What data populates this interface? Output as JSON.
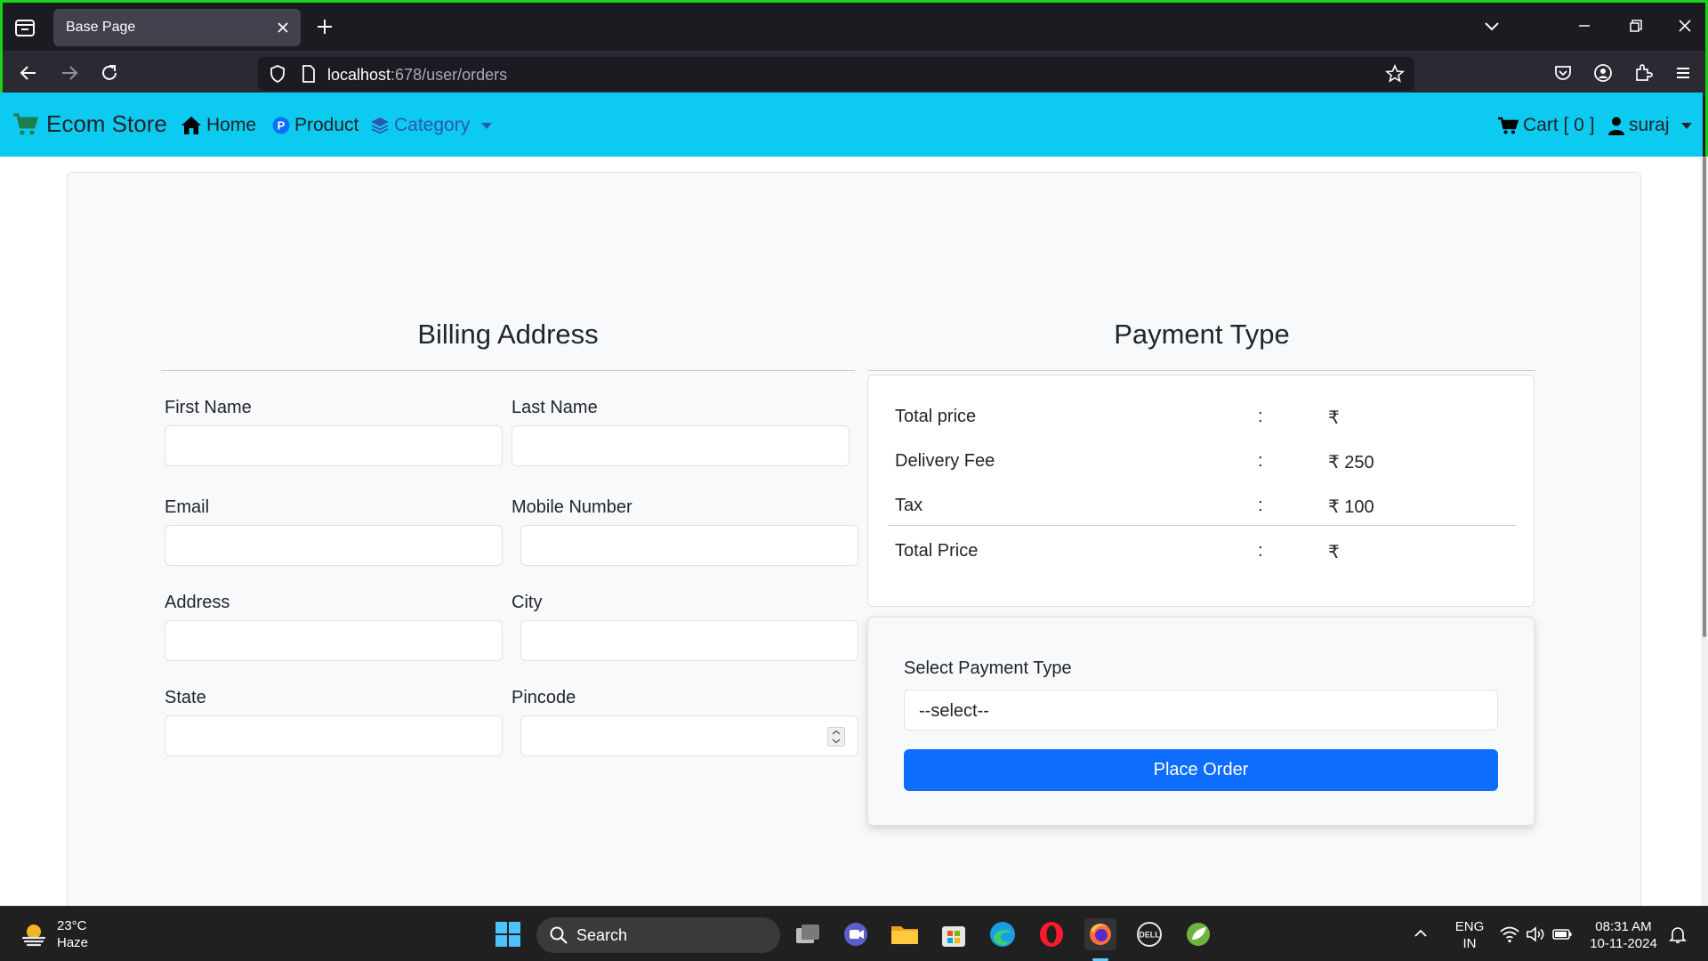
{
  "browser": {
    "tab_title": "Base Page",
    "url_host": "localhost",
    "url_path": ":678/user/orders"
  },
  "site_nav": {
    "brand": "Ecom Store",
    "home": "Home",
    "product": "Product",
    "category": "Category",
    "cart": "Cart [ 0 ]",
    "user": "suraj"
  },
  "billing": {
    "title": "Billing Address",
    "fields": {
      "first_name": "First Name",
      "last_name": "Last Name",
      "email": "Email",
      "mobile": "Mobile Number",
      "address": "Address",
      "city": "City",
      "state": "State",
      "pincode": "Pincode"
    }
  },
  "payment": {
    "title": "Payment Type",
    "summary": [
      {
        "label": "Total price",
        "sep": ":",
        "value": "₹"
      },
      {
        "label": "Delivery Fee",
        "sep": ":",
        "value": "₹ 250"
      },
      {
        "label": "Tax",
        "sep": ":",
        "value": "₹ 100"
      },
      {
        "label": "Total Price",
        "sep": ":",
        "value": "₹"
      }
    ],
    "select_label": "Select Payment Type",
    "select_value": "--select--",
    "place_order": "Place Order"
  },
  "taskbar": {
    "temp": "23°C",
    "weather": "Haze",
    "search": "Search",
    "lang1": "ENG",
    "lang2": "IN",
    "time": "08:31 AM",
    "date": "10-11-2024"
  },
  "colors": {
    "nav_bg": "#0dcaf0",
    "primary": "#0d6efd",
    "frame": "#19d219"
  }
}
